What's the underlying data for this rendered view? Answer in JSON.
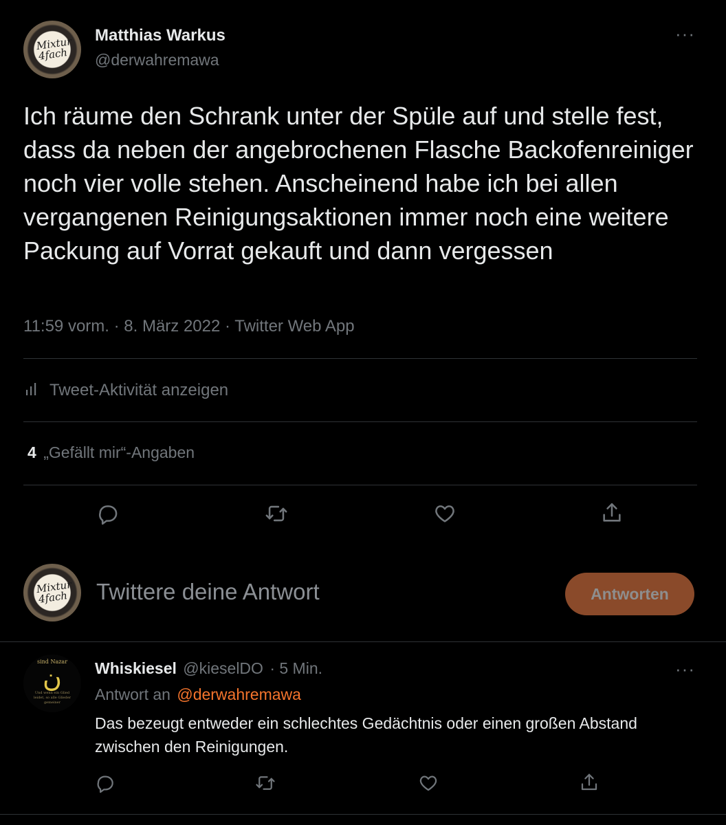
{
  "tweet": {
    "author_name": "Matthias Warkus",
    "author_handle": "@derwahremawa",
    "avatar_text": "Mixtur 4fach",
    "text": "Ich räume den Schrank unter der Spüle auf und stelle fest, dass da neben der angebrochenen Flasche Backofenreiniger noch vier volle stehen. Anscheinend habe ich bei allen vergangenen Reinigungsaktionen immer noch eine weitere Packung auf Vorrat gekauft und dann vergessen",
    "meta": "11:59 vorm. · 8. März 2022 · Twitter Web App",
    "activity_label": "Tweet-Aktivität anzeigen",
    "likes_count": "4",
    "likes_label": "„Gefällt mir“-Angaben",
    "more_icon": "more-dots-icon"
  },
  "composer": {
    "placeholder": "Twittere deine Antwort",
    "button_label": "Antworten",
    "avatar_text": "Mixtur 4fach"
  },
  "reply": {
    "author_name": "Whiskiesel",
    "author_handle": "@kieselDO",
    "time": "· 5 Min.",
    "reply_to_prefix": "Antwort an",
    "reply_to_handle": "@derwahremawa",
    "text": "Das bezeugt entweder ein schlechtes Gedächtnis oder einen großen Abstand zwischen den Reinigungen.",
    "avatar_top": "sind Nazar",
    "avatar_glyph": "ن",
    "avatar_bottom": "Und wenn ein Glied leidet, so alle Glieder gemeiner"
  },
  "colors": {
    "background": "#000000",
    "text": "#e7e9ea",
    "muted": "#71767b",
    "divider": "#2f3336",
    "accent": "#f4742c",
    "button_disabled": "#8a4a2a"
  }
}
